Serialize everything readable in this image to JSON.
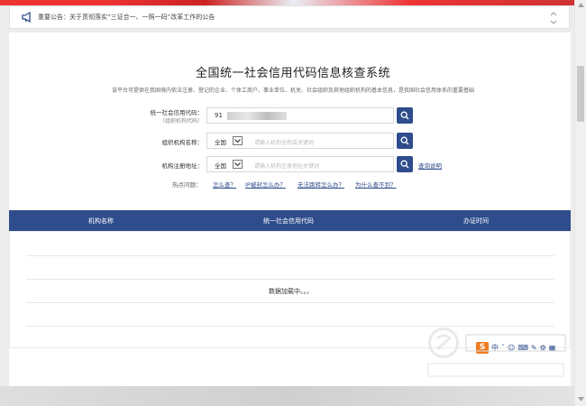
{
  "notice": {
    "text": "重要公告：关于贯彻落实“三证合一、一照一码”改革工作的公告",
    "megaphone_icon": "megaphone-icon",
    "updown_icon": "up-down-arrows-icon"
  },
  "header": {
    "title": "全国统一社会信用代码信息核查系统",
    "subtitle": "该平台可提供在我国境内依法注册、登记的企业、个体工商户、事业单位、机关、社会组织及其他组织机构的基本信息，是我国社会信用体系的重要基础"
  },
  "search": {
    "code_label": "统一社会信用代码：",
    "code_sublabel": "（组织机构代码）",
    "code_value": "91",
    "name_label": "组织机构名称：",
    "name_region": "全国",
    "name_placeholder": "请输入机构全称或关键词",
    "addr_label": "机构注册地址：",
    "addr_region": "全国",
    "addr_placeholder": "请输入机构注册地址关键词",
    "help_link": "查询说明"
  },
  "hot": {
    "label": "热点问题：",
    "q1": "怎么查？",
    "q2": "IP被封怎么办？",
    "q3": "无法跳转怎么办？",
    "q4": "为什么查不到？"
  },
  "table": {
    "columns": [
      "机构名称",
      "统一社会信用代码",
      "办证时间"
    ],
    "loading_text": "数据加载中。。。"
  },
  "ime": {
    "logo": "S",
    "items": [
      "中",
      "ˇ",
      "☺",
      "⌨",
      "✎",
      "⚙",
      "▦"
    ]
  },
  "colors": {
    "accent": "#2f4d8c",
    "ime_orange": "#f07c22"
  }
}
